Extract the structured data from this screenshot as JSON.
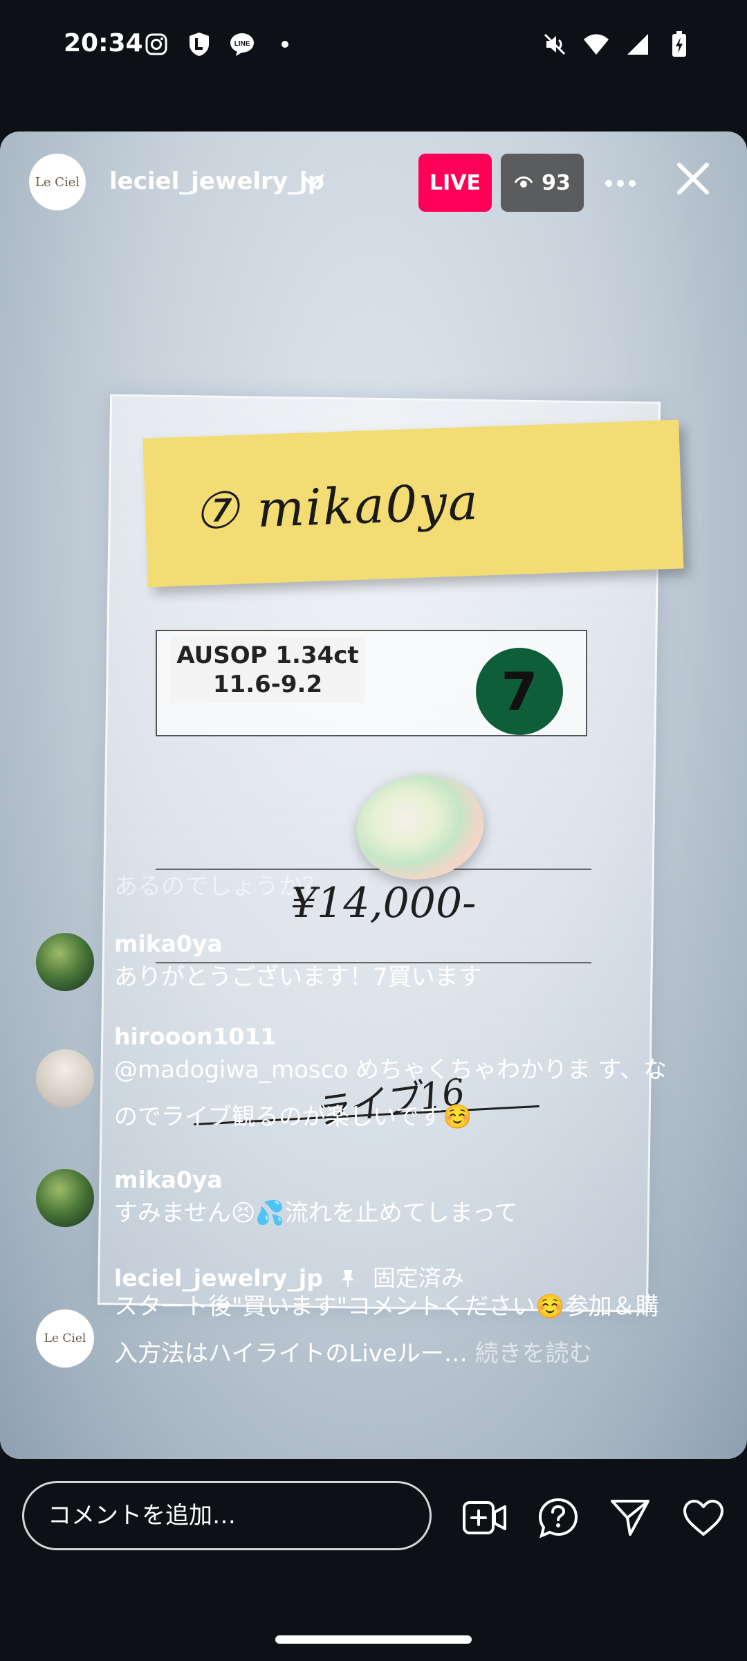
{
  "status_bar": {
    "time": "20:34",
    "left_icons": [
      "instagram-icon",
      "l-shield-icon",
      "line-icon",
      "dot-icon"
    ],
    "right_icons": [
      "mute-icon",
      "wifi-icon",
      "signal-icon",
      "battery-charging-icon"
    ]
  },
  "live": {
    "host_username": "leciel_jewelry_jp",
    "host_avatar_text": "Le Ciel",
    "live_label": "LIVE",
    "viewer_count": "93",
    "accent_color": "#fe0058"
  },
  "video": {
    "sticky_note": "⑦ mika0ya",
    "label_line1": "AUSOP 1.34ct",
    "label_line2": "11.6-9.2",
    "number_sticker": "7",
    "price": "¥14,000-",
    "handnote": "ライブ16"
  },
  "comments": {
    "faded_line": "あるのでしょうか？",
    "items": [
      {
        "username": "mika0ya",
        "text": "ありがとうございます！7買います"
      },
      {
        "username": "hirooon1011",
        "text": "@madogiwa_mosco めちゃくちゃわかりま す、なのでライブ観るのが楽しいです☺️"
      },
      {
        "username": "mika0ya",
        "text": "すみません😣💦流れを止めてしまって"
      },
      {
        "username": "leciel_jewelry_jp",
        "pinned_label": "固定済み",
        "text": "スタート後\"買います\"コメントください☺️参加＆購入方法はハイライトのLiveルー…",
        "read_more": "続きを読む",
        "avatar_text": "Le Ciel"
      }
    ]
  },
  "bottom_bar": {
    "comment_placeholder": "コメントを追加…",
    "icons": [
      "add-video-icon",
      "question-icon",
      "send-icon",
      "heart-icon"
    ]
  }
}
